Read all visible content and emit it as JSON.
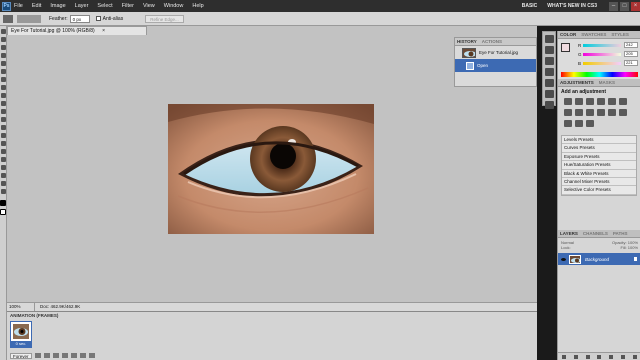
{
  "app": {
    "logo": "Ps"
  },
  "menu": [
    "File",
    "Edit",
    "Image",
    "Layer",
    "Select",
    "Filter",
    "View",
    "Window",
    "Help"
  ],
  "workspace": {
    "basic": "BASIC",
    "whats_new": "WHAT'S NEW IN CS3"
  },
  "options": {
    "feather_label": "Feather:",
    "feather_value": "0 px",
    "antialias_label": "Anti-alias",
    "refine_label": "Refine Edge..."
  },
  "document": {
    "tab_title": "Eye For Tutorial.jpg @ 100% (RGB/8)",
    "close": "×",
    "zoom": "100%",
    "doc_size": "Doc: 462.9K/462.9K"
  },
  "history": {
    "tabs": [
      "HISTORY",
      "ACTIONS"
    ],
    "snapshot": "Eye For Tutorial.jpg",
    "step": "Open"
  },
  "color_panel": {
    "tabs": [
      "COLOR",
      "SWATCHES",
      "STYLES"
    ],
    "r": {
      "label": "R",
      "value": "242"
    },
    "g": {
      "label": "G",
      "value": "205"
    },
    "b": {
      "label": "B",
      "value": "221"
    },
    "fg_color": "#F2CDDD"
  },
  "adjustments": {
    "tabs": [
      "ADJUSTMENTS",
      "MASKS"
    ],
    "header": "Add an adjustment",
    "presets": [
      "Levels Presets",
      "Curves Presets",
      "Exposure Presets",
      "Hue/Saturation Presets",
      "Black & White Presets",
      "Channel Mixer Presets",
      "Selective Color Presets"
    ]
  },
  "layers": {
    "tabs": [
      "LAYERS",
      "CHANNELS",
      "PATHS"
    ],
    "blend": "Normal",
    "opacity": "Opacity: 100%",
    "lock": "Lock:",
    "fill": "Fill: 100%",
    "layer_name": "Background"
  },
  "animation": {
    "title": "ANIMATION (FRAMES)",
    "frame_time": "0 sec.",
    "loop": "Forever"
  },
  "colors": {
    "selection_blue": "#3D6AB3",
    "menubar": "#2E2E2E",
    "canvas_bg": "#C2C2C2"
  },
  "icons": [
    "photoshop-logo",
    "minimize-icon",
    "maximize-icon",
    "close-icon",
    "eye-icon",
    "lock-icon",
    "play-icon",
    "stop-icon"
  ]
}
